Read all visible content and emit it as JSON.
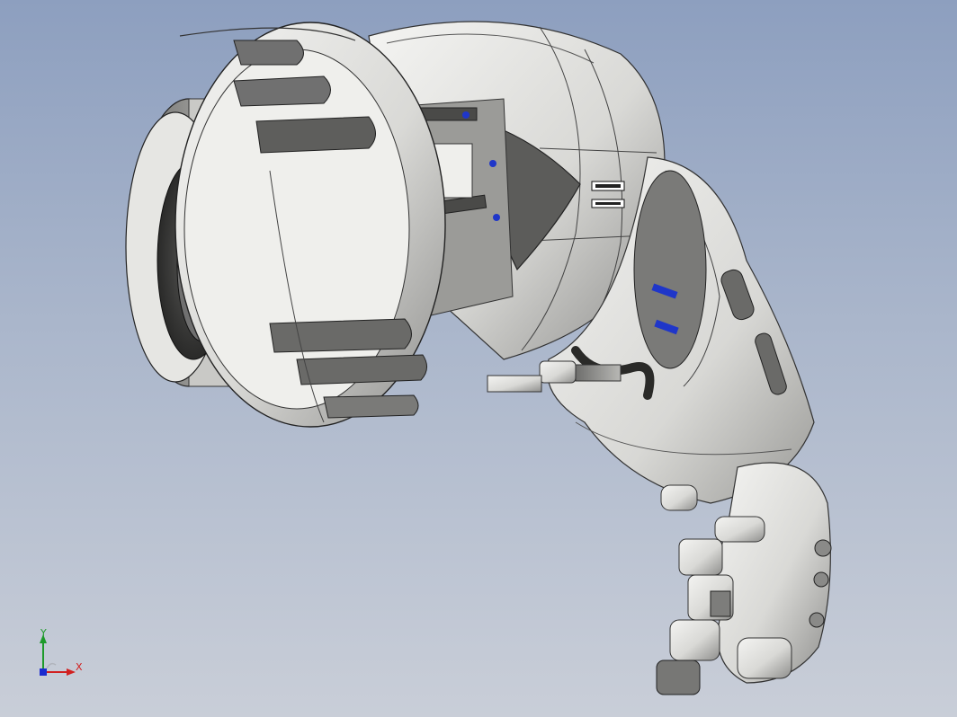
{
  "viewport": {
    "background_top": "#8d9fbf",
    "background_bottom": "#c9ced8",
    "model": "robotic-arm-assembly"
  },
  "triad": {
    "x_label": "X",
    "y_label": "Y",
    "x_color": "#d12020",
    "y_color": "#1d9a2a",
    "z_color": "#1a2bd0"
  }
}
